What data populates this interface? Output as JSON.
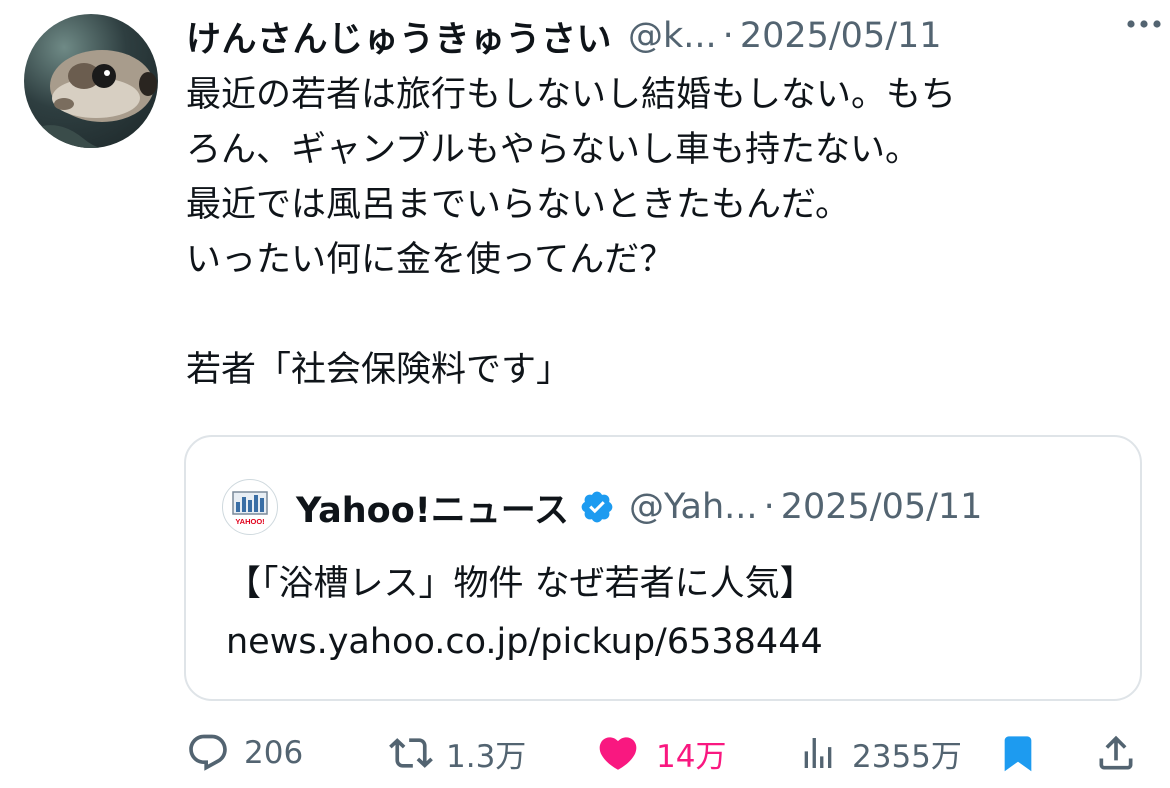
{
  "tweet": {
    "author_name": "けんさんじゅうきゅうさい",
    "handle": "@k...",
    "separator": "·",
    "date": "2025/05/11",
    "lines": [
      "最近の若者は旅行もしないし結婚もしない。もち",
      "ろん、ギャンブルもやらないし車も持たない。",
      "最近では風呂までいらないときたもんだ。",
      "いったい何に金を使ってんだ？",
      "",
      "若者「社会保険料です」"
    ]
  },
  "quote": {
    "name": "Yahoo!ニュース",
    "handle": "@Yah...",
    "separator": "·",
    "date": "2025/05/11",
    "logo_text": "YAHOO!",
    "lines": [
      "【「浴槽レス」物件 なぜ若者に人気】",
      "news.yahoo.co.jp/pickup/6538444"
    ]
  },
  "actions": {
    "replies": "206",
    "reposts": "1.3万",
    "likes": "14万",
    "views": "2355万"
  },
  "icons": {
    "more": "more-icon",
    "verified": "verified-badge-icon",
    "reply": "reply-icon",
    "repost": "repost-icon",
    "like": "heart-icon",
    "views": "views-icon",
    "bookmark": "bookmark-icon",
    "share": "share-icon"
  },
  "colors": {
    "text": "#0f1419",
    "secondary": "#536471",
    "like": "#f91880",
    "accent": "#1d9bf0",
    "border": "#dfe4e8"
  }
}
